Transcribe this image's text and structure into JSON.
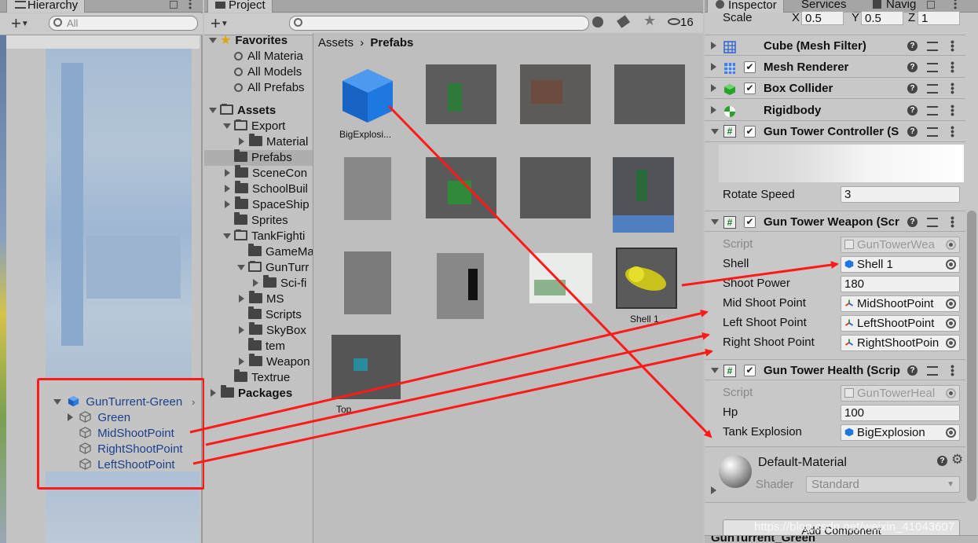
{
  "hierarchy": {
    "tab_label": "Hierarchy",
    "search_placeholder": "All",
    "items": [
      {
        "label": "GunTurrent-Green"
      },
      {
        "label": "Green"
      },
      {
        "label": "MidShootPoint"
      },
      {
        "label": "RightShootPoint"
      },
      {
        "label": "LeftShootPoint"
      }
    ]
  },
  "project": {
    "tab_label": "Project",
    "hidden_count": "16",
    "breadcrumb": [
      "Assets",
      "Prefabs"
    ],
    "tree": [
      {
        "label": "Favorites",
        "indent": 0,
        "expanded": true,
        "kind": "star",
        "bold": true
      },
      {
        "label": "All Materia",
        "indent": 1,
        "kind": "search"
      },
      {
        "label": "All Models",
        "indent": 1,
        "kind": "search"
      },
      {
        "label": "All Prefabs",
        "indent": 1,
        "kind": "search"
      },
      {
        "label": "Assets",
        "indent": 0,
        "expanded": true,
        "kind": "folder",
        "bold": true
      },
      {
        "label": "Export",
        "indent": 1,
        "expanded": true,
        "kind": "folder"
      },
      {
        "label": "Material",
        "indent": 2,
        "expanded": false,
        "kind": "folder"
      },
      {
        "label": "Prefabs",
        "indent": 1,
        "kind": "folder",
        "selected": true
      },
      {
        "label": "SceneCon",
        "indent": 1,
        "expanded": false,
        "kind": "folder"
      },
      {
        "label": "SchoolBuil",
        "indent": 1,
        "expanded": false,
        "kind": "folder"
      },
      {
        "label": "SpaceShip",
        "indent": 1,
        "expanded": false,
        "kind": "folder"
      },
      {
        "label": "Sprites",
        "indent": 1,
        "kind": "folder"
      },
      {
        "label": "TankFighti",
        "indent": 1,
        "expanded": true,
        "kind": "folder"
      },
      {
        "label": "GameMa",
        "indent": 2,
        "kind": "folder"
      },
      {
        "label": "GunTurr",
        "indent": 2,
        "expanded": true,
        "kind": "folder"
      },
      {
        "label": "Sci-fi",
        "indent": 3,
        "expanded": false,
        "kind": "folder"
      },
      {
        "label": "MS",
        "indent": 2,
        "expanded": false,
        "kind": "folder"
      },
      {
        "label": "Scripts",
        "indent": 2,
        "kind": "folder"
      },
      {
        "label": "SkyBox",
        "indent": 2,
        "expanded": false,
        "kind": "folder"
      },
      {
        "label": "tem",
        "indent": 2,
        "kind": "folder"
      },
      {
        "label": "Weapon",
        "indent": 2,
        "expanded": false,
        "kind": "folder"
      },
      {
        "label": "Textrue",
        "indent": 1,
        "kind": "folder"
      },
      {
        "label": "Packages",
        "indent": 0,
        "expanded": false,
        "kind": "folder",
        "bold": true
      }
    ],
    "assets": [
      {
        "label": "BigExplosi...",
        "icon": "prefab-cube-icon"
      },
      {
        "label": "Shell 1",
        "icon": "shell-icon"
      },
      {
        "label": "Top",
        "icon": "blurred-thumbnail"
      }
    ]
  },
  "inspector": {
    "tabs": [
      "Inspector",
      "Services",
      "Navig"
    ],
    "scale": {
      "label": "Scale",
      "x_label": "X",
      "x": "0.5",
      "y_label": "Y",
      "y": "0.5",
      "z_label": "Z",
      "z": "1"
    },
    "components": [
      {
        "title": "Cube (Mesh Filter)",
        "has_checkbox": false,
        "icon": "mesh-filter-icon"
      },
      {
        "title": "Mesh Renderer",
        "has_checkbox": true,
        "icon": "mesh-renderer-icon"
      },
      {
        "title": "Box Collider",
        "has_checkbox": true,
        "icon": "box-collider-icon"
      },
      {
        "title": "Rigidbody",
        "has_checkbox": false,
        "icon": "rigidbody-icon"
      },
      {
        "title": "Gun Tower Controller (S",
        "has_checkbox": true,
        "icon": "script-icon"
      }
    ],
    "rotate_speed": {
      "label": "Rotate Speed",
      "value": "3"
    },
    "weapon": {
      "title": "Gun Tower Weapon (Scr",
      "script_label": "Script",
      "script_value": "GunTowerWea",
      "shell_label": "Shell",
      "shell_value": "Shell 1",
      "shoot_power_label": "Shoot Power",
      "shoot_power_value": "180",
      "mid_label": "Mid Shoot Point",
      "mid_value": "MidShootPoint",
      "left_label": "Left Shoot Point",
      "left_value": "LeftShootPoint",
      "right_label": "Right Shoot Point",
      "right_value": "RightShootPoin"
    },
    "health": {
      "title": "Gun Tower Health (Scrip",
      "script_label": "Script",
      "script_value": "GunTowerHeal",
      "hp_label": "Hp",
      "hp_value": "100",
      "explosion_label": "Tank Explosion",
      "explosion_value": "BigExplosion"
    },
    "material": {
      "name": "Default-Material",
      "shader_label": "Shader",
      "shader_value": "Standard"
    },
    "add_component": "Add Component",
    "footer": "GunTurrent_Green",
    "watermark": "https://blog.csdn.net/weixin_41043607"
  },
  "colors": {
    "annotation": "#ff1a1a",
    "unity_blue": "#1e6fd0",
    "panel_bg": "#c2c2c2"
  }
}
